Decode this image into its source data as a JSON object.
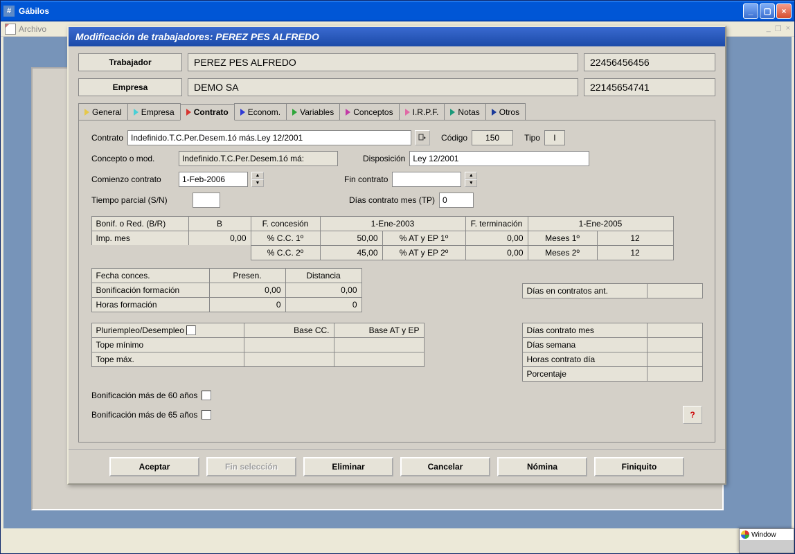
{
  "app": {
    "title": "Gábilos",
    "menu_file": "Archivo",
    "taskbar_label": "Window"
  },
  "dialog": {
    "title": "Modificación de trabajadores: PEREZ PES ALFREDO"
  },
  "header": {
    "worker_label": "Trabajador",
    "worker_name": "PEREZ PES ALFREDO",
    "worker_id": "22456456456",
    "company_label": "Empresa",
    "company_name": "DEMO SA",
    "company_id": "22145654741"
  },
  "tabs": {
    "general": "General",
    "empresa": "Empresa",
    "contrato": "Contrato",
    "econom": "Econom.",
    "variables": "Variables",
    "conceptos": "Conceptos",
    "irpf": "I.R.P.F.",
    "notas": "Notas",
    "otros": "Otros"
  },
  "contract": {
    "label": "Contrato",
    "value": "Indefinido.T.C.Per.Desem.1ó más.Ley 12/2001",
    "codigo_label": "Código",
    "codigo": "150",
    "tipo_label": "Tipo",
    "tipo": "I",
    "concepto_label": "Concepto o mod.",
    "concepto": "Indefinido.T.C.Per.Desem.1ó má:",
    "disposicion_label": "Disposición",
    "disposicion": "Ley 12/2001",
    "start_label": "Comienzo contrato",
    "start": "1-Feb-2006",
    "end_label": "Fin contrato",
    "end": "",
    "partial_label": "Tiempo parcial (S/N)",
    "partial": "",
    "dias_tp_label": "Días contrato mes (TP)",
    "dias_tp": "0"
  },
  "bonif": {
    "br_label": "Bonif. o Red. (B/R)",
    "br": "B",
    "fconc_label": "F. concesión",
    "fconc": "1-Ene-2003",
    "fterm_label": "F. terminación",
    "fterm": "1-Ene-2005",
    "imp_label": "Imp. mes",
    "imp": "0,00",
    "cc1_label": "% C.C. 1º",
    "cc1": "50,00",
    "at1_label": "% AT y EP 1º",
    "at1": "0,00",
    "m1_label": "Meses 1º",
    "m1": "12",
    "cc2_label": "% C.C. 2º",
    "cc2": "45,00",
    "at2_label": "% AT y EP 2º",
    "at2": "0,00",
    "m2_label": "Meses 2º",
    "m2": "12"
  },
  "formacion": {
    "fecha_label": "Fecha conces.",
    "presen_label": "Presen.",
    "distancia_label": "Distancia",
    "bonif_label": "Bonificación formación",
    "bonif_p": "0,00",
    "bonif_d": "0,00",
    "horas_label": "Horas formación",
    "horas_p": "0",
    "horas_d": "0",
    "dias_ant_label": "Días en contratos ant.",
    "dias_ant": ""
  },
  "pluri": {
    "label": "Pluriempleo/Desempleo",
    "basecc_label": "Base CC.",
    "baseat_label": "Base AT y EP",
    "min_label": "Tope mínimo",
    "max_label": "Tope máx.",
    "dias_mes_label": "Días contrato mes",
    "dias_sem_label": "Días semana",
    "horas_dia_label": "Horas contrato día",
    "porc_label": "Porcentaje"
  },
  "extra": {
    "b60_label": "Bonificación más de 60 años",
    "b65_label": "Bonificación más de 65 años",
    "help": "?"
  },
  "buttons": {
    "aceptar": "Aceptar",
    "fin": "Fin selección",
    "eliminar": "Eliminar",
    "cancelar": "Cancelar",
    "nomina": "Nómina",
    "finiquito": "Finiquito"
  }
}
